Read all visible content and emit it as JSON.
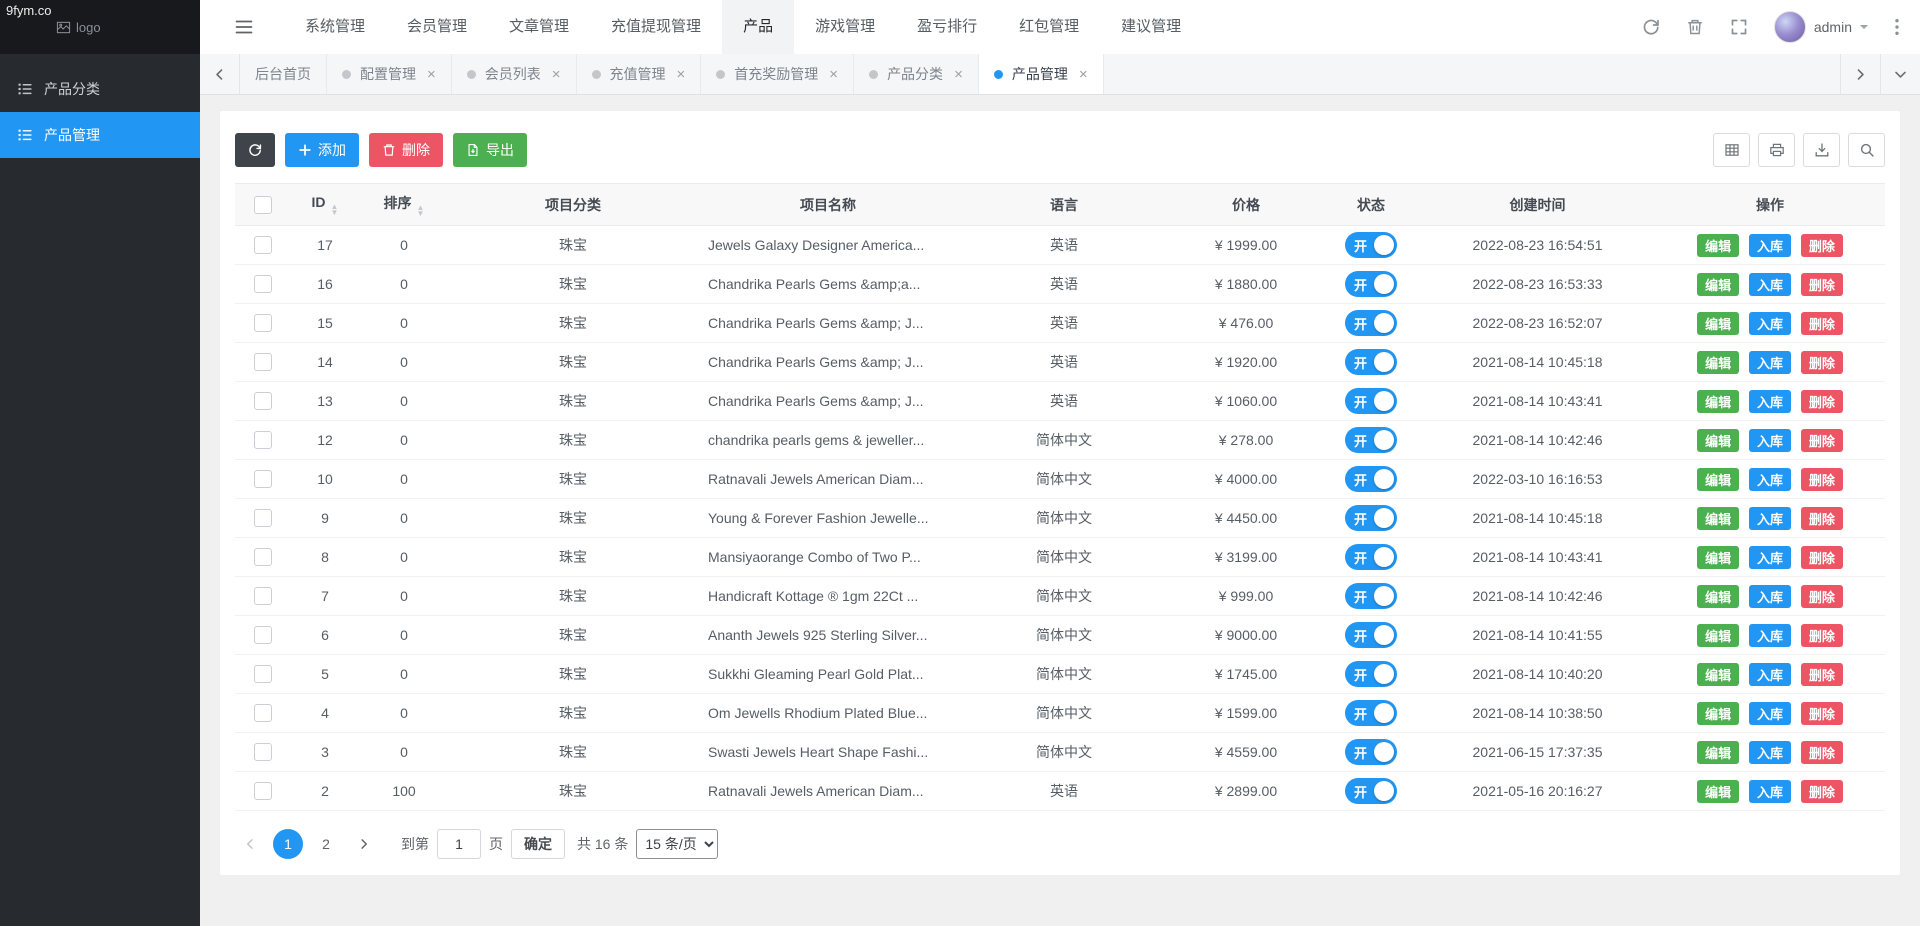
{
  "colors": {
    "primary": "#2196f3",
    "success": "#4caf50",
    "danger": "#ed5565",
    "toolbar_dark": "#3e444a",
    "sidebar_bg": "#272b2f",
    "logo_bg": "#17191c",
    "page_bg": "#f0f0f0"
  },
  "logo": {
    "watermark": "9fym.co",
    "alt_text": "logo"
  },
  "topnav": {
    "items": [
      {
        "label": "系统管理",
        "active": false
      },
      {
        "label": "会员管理",
        "active": false
      },
      {
        "label": "文章管理",
        "active": false
      },
      {
        "label": "充值提现管理",
        "active": false
      },
      {
        "label": "产品",
        "active": true
      },
      {
        "label": "游戏管理",
        "active": false
      },
      {
        "label": "盈亏排行",
        "active": false
      },
      {
        "label": "红包管理",
        "active": false
      },
      {
        "label": "建议管理",
        "active": false
      }
    ],
    "username": "admin"
  },
  "tabbar": {
    "tabs": [
      {
        "label": "后台首页",
        "dot": false,
        "closable": false,
        "active": false
      },
      {
        "label": "配置管理",
        "dot": true,
        "closable": true,
        "active": false
      },
      {
        "label": "会员列表",
        "dot": true,
        "closable": true,
        "active": false
      },
      {
        "label": "充值管理",
        "dot": true,
        "closable": true,
        "active": false
      },
      {
        "label": "首充奖励管理",
        "dot": true,
        "closable": true,
        "active": false
      },
      {
        "label": "产品分类",
        "dot": true,
        "closable": true,
        "active": false
      },
      {
        "label": "产品管理",
        "dot": true,
        "closable": true,
        "active": true
      }
    ]
  },
  "sidebar": {
    "items": [
      {
        "label": "产品分类",
        "active": false
      },
      {
        "label": "产品管理",
        "active": true
      }
    ]
  },
  "toolbar": {
    "add_label": "添加",
    "delete_label": "删除",
    "export_label": "导出"
  },
  "table": {
    "columns": [
      {
        "label": "ID",
        "sortable": true
      },
      {
        "label": "排序",
        "sortable": true
      },
      {
        "label": "项目分类",
        "sortable": false
      },
      {
        "label": "项目名称",
        "sortable": false
      },
      {
        "label": "语言",
        "sortable": false
      },
      {
        "label": "价格",
        "sortable": false
      },
      {
        "label": "状态",
        "sortable": false
      },
      {
        "label": "创建时间",
        "sortable": false
      },
      {
        "label": "操作",
        "sortable": false
      }
    ],
    "row_actions": {
      "edit": "编辑",
      "stock": "入库",
      "delete": "删除"
    },
    "rows": [
      {
        "id": "17",
        "sort": "0",
        "category": "珠宝",
        "name": "Jewels Galaxy Designer America...",
        "language": "英语",
        "price": "¥ 1999.00",
        "status": "开",
        "created": "2022-08-23 16:54:51"
      },
      {
        "id": "16",
        "sort": "0",
        "category": "珠宝",
        "name": "Chandrika Pearls Gems &amp;a...",
        "language": "英语",
        "price": "¥ 1880.00",
        "status": "开",
        "created": "2022-08-23 16:53:33"
      },
      {
        "id": "15",
        "sort": "0",
        "category": "珠宝",
        "name": "Chandrika Pearls Gems &amp; J...",
        "language": "英语",
        "price": "¥ 476.00",
        "status": "开",
        "created": "2022-08-23 16:52:07"
      },
      {
        "id": "14",
        "sort": "0",
        "category": "珠宝",
        "name": "Chandrika Pearls Gems &amp; J...",
        "language": "英语",
        "price": "¥ 1920.00",
        "status": "开",
        "created": "2021-08-14 10:45:18"
      },
      {
        "id": "13",
        "sort": "0",
        "category": "珠宝",
        "name": "Chandrika Pearls Gems &amp; J...",
        "language": "英语",
        "price": "¥ 1060.00",
        "status": "开",
        "created": "2021-08-14 10:43:41"
      },
      {
        "id": "12",
        "sort": "0",
        "category": "珠宝",
        "name": "chandrika pearls gems & jeweller...",
        "language": "简体中文",
        "price": "¥ 278.00",
        "status": "开",
        "created": "2021-08-14 10:42:46"
      },
      {
        "id": "10",
        "sort": "0",
        "category": "珠宝",
        "name": "Ratnavali Jewels American Diam...",
        "language": "简体中文",
        "price": "¥ 4000.00",
        "status": "开",
        "created": "2022-03-10 16:16:53"
      },
      {
        "id": "9",
        "sort": "0",
        "category": "珠宝",
        "name": "Young & Forever Fashion Jewelle...",
        "language": "简体中文",
        "price": "¥ 4450.00",
        "status": "开",
        "created": "2021-08-14 10:45:18"
      },
      {
        "id": "8",
        "sort": "0",
        "category": "珠宝",
        "name": "Mansiyaorange Combo of Two P...",
        "language": "简体中文",
        "price": "¥ 3199.00",
        "status": "开",
        "created": "2021-08-14 10:43:41"
      },
      {
        "id": "7",
        "sort": "0",
        "category": "珠宝",
        "name": "Handicraft Kottage ® 1gm 22Ct ...",
        "language": "简体中文",
        "price": "¥ 999.00",
        "status": "开",
        "created": "2021-08-14 10:42:46"
      },
      {
        "id": "6",
        "sort": "0",
        "category": "珠宝",
        "name": "Ananth Jewels 925 Sterling Silver...",
        "language": "简体中文",
        "price": "¥ 9000.00",
        "status": "开",
        "created": "2021-08-14 10:41:55"
      },
      {
        "id": "5",
        "sort": "0",
        "category": "珠宝",
        "name": "Sukkhi Gleaming Pearl Gold Plat...",
        "language": "简体中文",
        "price": "¥ 1745.00",
        "status": "开",
        "created": "2021-08-14 10:40:20"
      },
      {
        "id": "4",
        "sort": "0",
        "category": "珠宝",
        "name": "Om Jewells Rhodium Plated Blue...",
        "language": "简体中文",
        "price": "¥ 1599.00",
        "status": "开",
        "created": "2021-08-14 10:38:50"
      },
      {
        "id": "3",
        "sort": "0",
        "category": "珠宝",
        "name": "Swasti Jewels Heart Shape Fashi...",
        "language": "简体中文",
        "price": "¥ 4559.00",
        "status": "开",
        "created": "2021-06-15 17:37:35"
      },
      {
        "id": "2",
        "sort": "100",
        "category": "珠宝",
        "name": "Ratnavali Jewels American Diam...",
        "language": "英语",
        "price": "¥ 2899.00",
        "status": "开",
        "created": "2021-05-16 20:16:27"
      }
    ]
  },
  "pagination": {
    "pages": [
      {
        "label": "1",
        "active": true
      },
      {
        "label": "2",
        "active": false
      }
    ],
    "goto_label": "到第",
    "goto_value": "1",
    "unit_label": "页",
    "confirm_label": "确定",
    "total_label": "共 16 条",
    "per_page_selected": "15 条/页"
  },
  "icons": {
    "close": "×",
    "sort_up": "▲",
    "sort_down": "▼"
  }
}
